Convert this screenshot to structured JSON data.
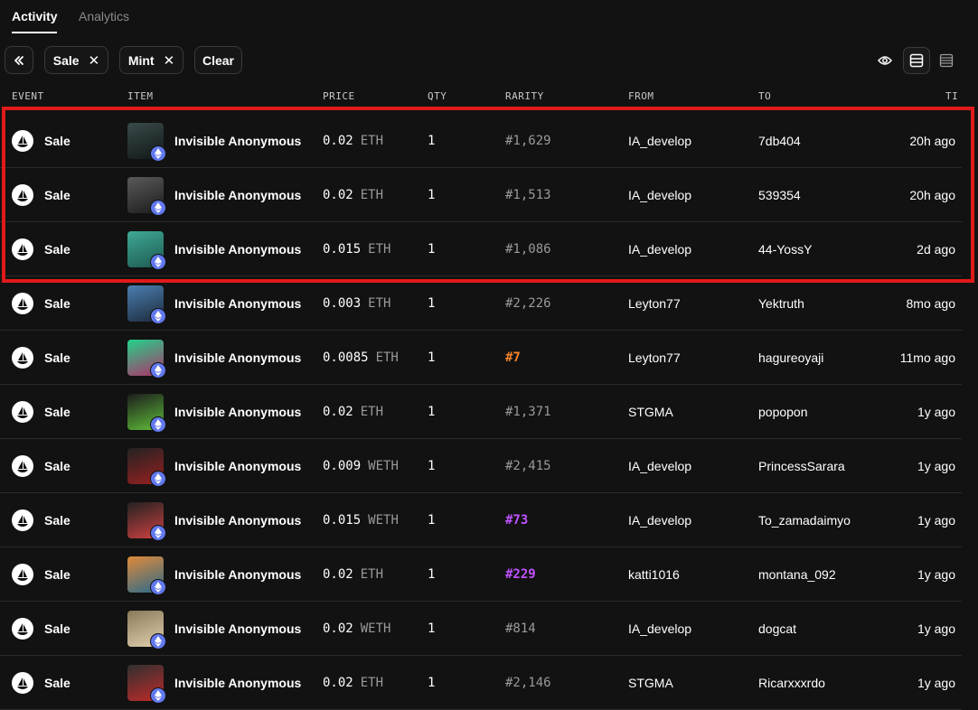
{
  "tabs": [
    {
      "label": "Activity"
    },
    {
      "label": "Analytics"
    }
  ],
  "filters": {
    "collapse_icon": "double-chevron-left-icon",
    "chips": [
      {
        "label": "Sale"
      },
      {
        "label": "Mint"
      }
    ],
    "clear_label": "Clear"
  },
  "view_controls": [
    "eye-icon",
    "table-view-icon",
    "list-view-icon"
  ],
  "columns": [
    "EVENT",
    "ITEM",
    "PRICE",
    "QTY",
    "RARITY",
    "FROM",
    "TO",
    "TI"
  ],
  "accent_colors": {
    "highlight": "#e01a1a",
    "rarity_orange": "#f5842b",
    "rarity_purple": "#c152ff",
    "eth_badge": "#6279ee"
  },
  "rows": [
    {
      "event": "Sale",
      "item": "Invisible Anonymous",
      "price": "0.02",
      "currency": "ETH",
      "qty": "1",
      "rarity": "#1,629",
      "rarity_color": "#9a9a9a",
      "from": "IA_develop",
      "to": "7db404",
      "time": "20h ago",
      "thumb": [
        "#3a4a4a",
        "#101818"
      ]
    },
    {
      "event": "Sale",
      "item": "Invisible Anonymous",
      "price": "0.02",
      "currency": "ETH",
      "qty": "1",
      "rarity": "#1,513",
      "rarity_color": "#9a9a9a",
      "from": "IA_develop",
      "to": "539354",
      "time": "20h ago",
      "thumb": [
        "#5a5a5a",
        "#1c1c1c"
      ]
    },
    {
      "event": "Sale",
      "item": "Invisible Anonymous",
      "price": "0.015",
      "currency": "ETH",
      "qty": "1",
      "rarity": "#1,086",
      "rarity_color": "#9a9a9a",
      "from": "IA_develop",
      "to": "44-YossY",
      "time": "2d ago",
      "thumb": [
        "#3fa896",
        "#1d5a50"
      ]
    },
    {
      "event": "Sale",
      "item": "Invisible Anonymous",
      "price": "0.003",
      "currency": "ETH",
      "qty": "1",
      "rarity": "#2,226",
      "rarity_color": "#9a9a9a",
      "from": "Leyton77",
      "to": "Yektruth",
      "time": "8mo ago",
      "thumb": [
        "#4b7fb0",
        "#1c2a3c"
      ]
    },
    {
      "event": "Sale",
      "item": "Invisible Anonymous",
      "price": "0.0085",
      "currency": "ETH",
      "qty": "1",
      "rarity": "#7",
      "rarity_color": "#f5842b",
      "from": "Leyton77",
      "to": "hagureoyaji",
      "time": "11mo ago",
      "thumb": [
        "#23d28a",
        "#b0306a"
      ]
    },
    {
      "event": "Sale",
      "item": "Invisible Anonymous",
      "price": "0.02",
      "currency": "ETH",
      "qty": "1",
      "rarity": "#1,371",
      "rarity_color": "#9a9a9a",
      "from": "STGMA",
      "to": "popopon",
      "time": "1y ago",
      "thumb": [
        "#1c1c1c",
        "#5fbf3a"
      ]
    },
    {
      "event": "Sale",
      "item": "Invisible Anonymous",
      "price": "0.009",
      "currency": "WETH",
      "qty": "1",
      "rarity": "#2,415",
      "rarity_color": "#9a9a9a",
      "from": "IA_develop",
      "to": "PrincessSarara",
      "time": "1y ago",
      "thumb": [
        "#222222",
        "#9a2020"
      ]
    },
    {
      "event": "Sale",
      "item": "Invisible Anonymous",
      "price": "0.015",
      "currency": "WETH",
      "qty": "1",
      "rarity": "#73",
      "rarity_color": "#c152ff",
      "from": "IA_develop",
      "to": "To_zamadaimyo",
      "time": "1y ago",
      "thumb": [
        "#222222",
        "#d04040"
      ]
    },
    {
      "event": "Sale",
      "item": "Invisible Anonymous",
      "price": "0.02",
      "currency": "ETH",
      "qty": "1",
      "rarity": "#229",
      "rarity_color": "#c152ff",
      "from": "katti1016",
      "to": "montana_092",
      "time": "1y ago",
      "thumb": [
        "#e08a3a",
        "#2a6a8a"
      ]
    },
    {
      "event": "Sale",
      "item": "Invisible Anonymous",
      "price": "0.02",
      "currency": "WETH",
      "qty": "1",
      "rarity": "#814",
      "rarity_color": "#9a9a9a",
      "from": "IA_develop",
      "to": "dogcat",
      "time": "1y ago",
      "thumb": [
        "#8a7a5a",
        "#e0d0b0"
      ]
    },
    {
      "event": "Sale",
      "item": "Invisible Anonymous",
      "price": "0.02",
      "currency": "ETH",
      "qty": "1",
      "rarity": "#2,146",
      "rarity_color": "#9a9a9a",
      "from": "STGMA",
      "to": "Ricarxxxrdo",
      "time": "1y ago",
      "thumb": [
        "#303030",
        "#c02a2a"
      ]
    }
  ]
}
